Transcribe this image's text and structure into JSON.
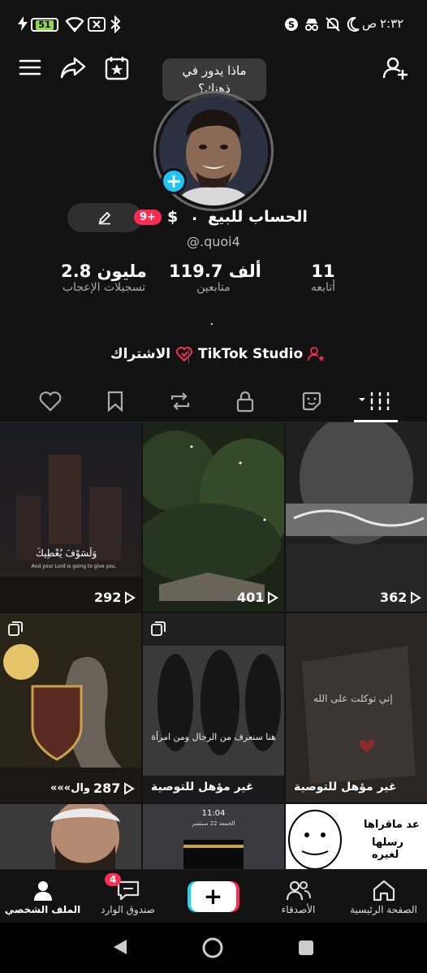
{
  "status_bar": {
    "time": "٢:٣٢",
    "am_pm": "ص",
    "battery": "51"
  },
  "header": {
    "bubble_text_line1": "ماذا يدور في",
    "bubble_text_line2": "ذهنك؟",
    "icons": [
      "menu-icon",
      "share-icon",
      "calendar-star-icon",
      "add-user-icon"
    ]
  },
  "profile": {
    "name": "الحساب للبيع",
    "dot": ".",
    "dollar": "$",
    "badge": "9+",
    "handle": "@.quoi4",
    "stats": [
      {
        "value": "11",
        "label": "أتابعه"
      },
      {
        "value": "119.7 ألف",
        "label": "متابعين"
      },
      {
        "value": "2.8 مليون",
        "label": "تسجيلات الإعجاب"
      }
    ],
    "bio": ".",
    "studio_label": "TikTok Studio",
    "subscribe_label": "الاشتراك"
  },
  "tabs": [
    "videos-tab",
    "favorites-tab",
    "private-tab",
    "reposts-tab",
    "saved-tab",
    "liked-tab"
  ],
  "grid": [
    {
      "count": "292",
      "caption": "",
      "overlay_text": "وَلَسَوْفَ يُعْطِيكَ",
      "overlay_sub": "And your Lord is going to give you."
    },
    {
      "count": "401",
      "caption": ""
    },
    {
      "count": "362",
      "caption": ""
    },
    {
      "count": "287",
      "caption": "",
      "prefix": "«««وال"
    },
    {
      "count": "",
      "caption": "غير مؤهل للتوصية",
      "overlay_text": "هنا سنعرف من الرجال ومن امرأة"
    },
    {
      "count": "",
      "caption": "غير مؤهل للتوصية",
      "overlay_text": "إني توكلت على الله"
    },
    {
      "count": "",
      "caption": ""
    },
    {
      "count": "",
      "caption": "",
      "overlay_text": "11:04",
      "overlay_sub": "الجمعة 22 سبتمبر"
    },
    {
      "count": "",
      "caption": "",
      "overlay_text": "عد ماقراها",
      "overlay_sub": "رسلها لغيره"
    }
  ],
  "bottom_nav": {
    "home": "الصفحة الرئيسية",
    "friends": "الأصدقاء",
    "inbox": "صندوق الوارد",
    "inbox_badge": "4",
    "profile": "الملف الشخصي",
    "plus": "+"
  },
  "colors": {
    "accent_red": "#fe2c55",
    "accent_cyan": "#20d5ec",
    "background": "#121212"
  }
}
